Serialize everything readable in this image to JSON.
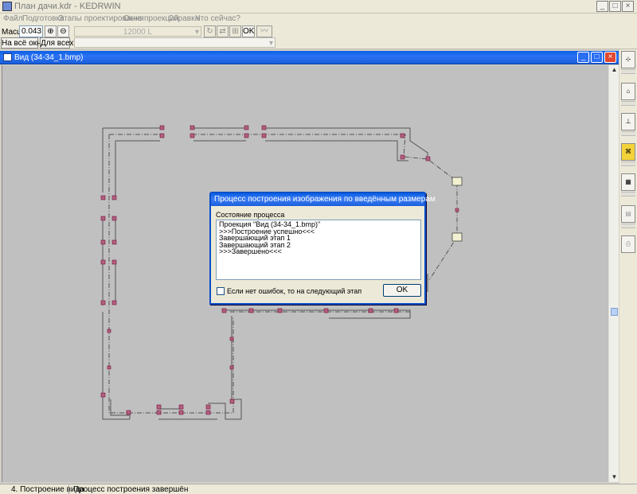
{
  "window": {
    "title": "План дачи.kdr - KEDRWIN",
    "min": "_",
    "max": "□",
    "close": "×"
  },
  "menu": [
    "Файл",
    "Подготовка",
    "Этапы проектирования",
    "Окна проекций",
    "Справка",
    "Что сейчас?"
  ],
  "toolbar": {
    "scale_label": "Масшт",
    "scale_value": "0.043",
    "fit_window": "На всё окно",
    "fit_all": "Для всех",
    "length_value": "12000 L",
    "ok": "OK"
  },
  "child": {
    "title": "Вид (34-34_1.bmp)"
  },
  "dialog": {
    "title": "Процесс построения изображения по введённым размерам",
    "group_label": "Состояние процесса",
    "log": [
      "Проекция \"Вид (34-34_1.bmp)\"",
      ">>>Построение успешно<<<",
      "Завершающий этап 1",
      "Завершающий этап 2",
      ">>>Завершено<<<"
    ],
    "checkbox_label": "Если нет ошибок, то на следующий этап",
    "ok_label": "OK"
  },
  "status": {
    "step": "4. Построение вида",
    "message": "Процесс построения завершён"
  },
  "colors": {
    "node": "#c2185b",
    "node_fill": "#b06080",
    "wall": "#555555",
    "accent": "#0a5fe3"
  }
}
